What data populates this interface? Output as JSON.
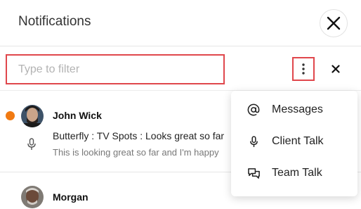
{
  "header": {
    "title": "Notifications"
  },
  "filter": {
    "placeholder": "Type to filter"
  },
  "notifications": [
    {
      "sender": "John Wick",
      "subject": "Butterfly : TV Spots : Looks great so far",
      "preview": "This is looking great so far and I'm happy",
      "unread": true
    },
    {
      "sender": "Morgan",
      "unread": false
    }
  ],
  "menu": {
    "items": [
      {
        "label": "Messages",
        "icon": "at-icon"
      },
      {
        "label": "Client Talk",
        "icon": "microphone-icon"
      },
      {
        "label": "Team Talk",
        "icon": "chat-bubbles-icon"
      }
    ]
  },
  "colors": {
    "unread_dot": "#f17a12",
    "highlight_border": "#e0474c"
  }
}
